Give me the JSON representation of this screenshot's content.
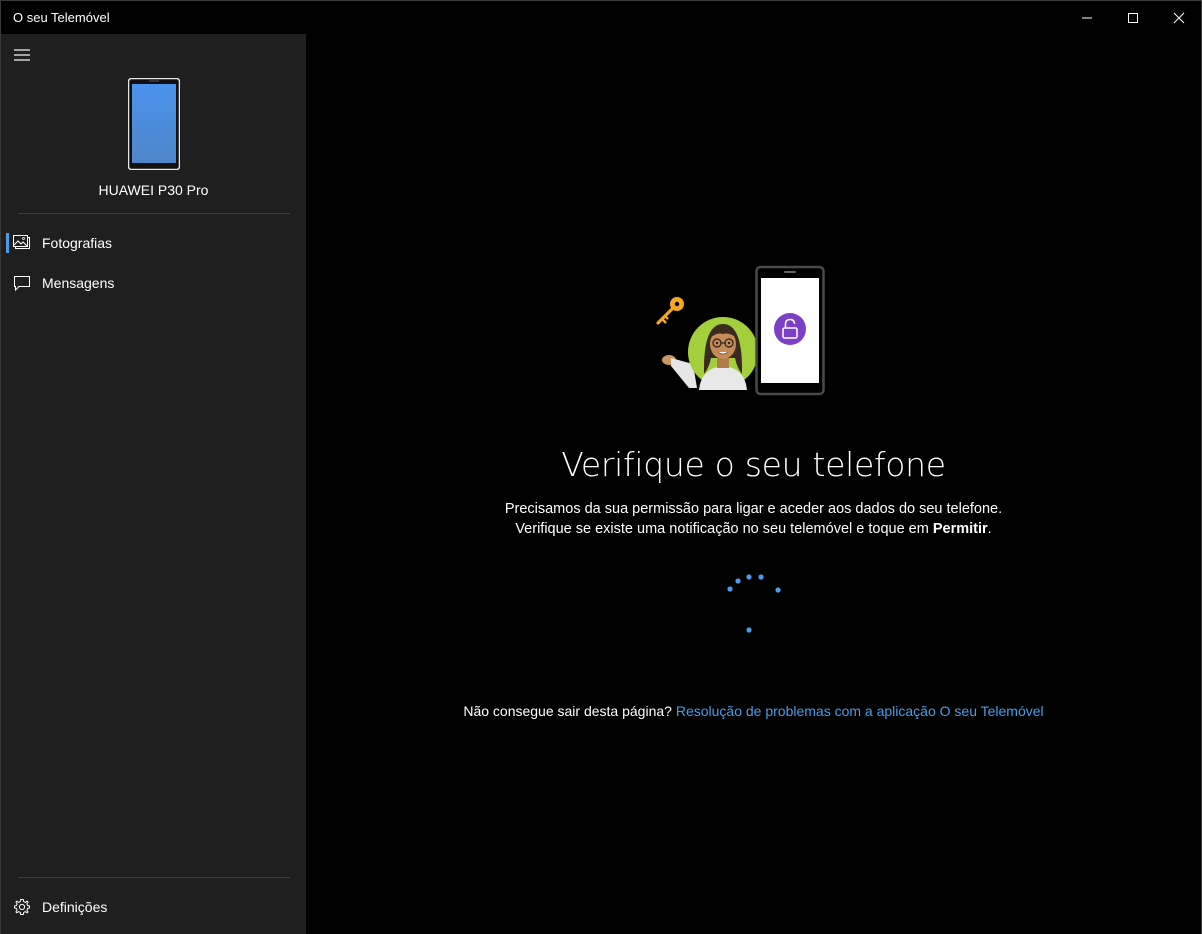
{
  "window": {
    "title": "O seu Telemóvel"
  },
  "sidebar": {
    "device_name": "HUAWEI P30 Pro",
    "items": [
      {
        "label": "Fotografias",
        "icon": "photos-icon",
        "selected": true
      },
      {
        "label": "Mensagens",
        "icon": "messages-icon",
        "selected": false
      }
    ],
    "settings_label": "Definições"
  },
  "main": {
    "heading": "Verifique o seu telefone",
    "desc_line1": "Precisamos da sua permissão para ligar e aceder aos dados do seu telefone.",
    "desc_line2_prefix": "Verifique se existe uma notificação no seu telemóvel e toque em",
    "desc_line2_bold": "Permitir",
    "desc_line2_suffix": ".",
    "help_text": "Não consegue sair desta página?",
    "help_link": "Resolução de problemas com a aplicação O seu Telemóvel"
  },
  "colors": {
    "accent": "#4c9be8",
    "sidebar_bg": "#1f1f1f",
    "main_bg": "#000000",
    "lock_purple": "#7b3fc8",
    "avatar_green": "#a4cf3c",
    "key_orange": "#f6a623"
  }
}
